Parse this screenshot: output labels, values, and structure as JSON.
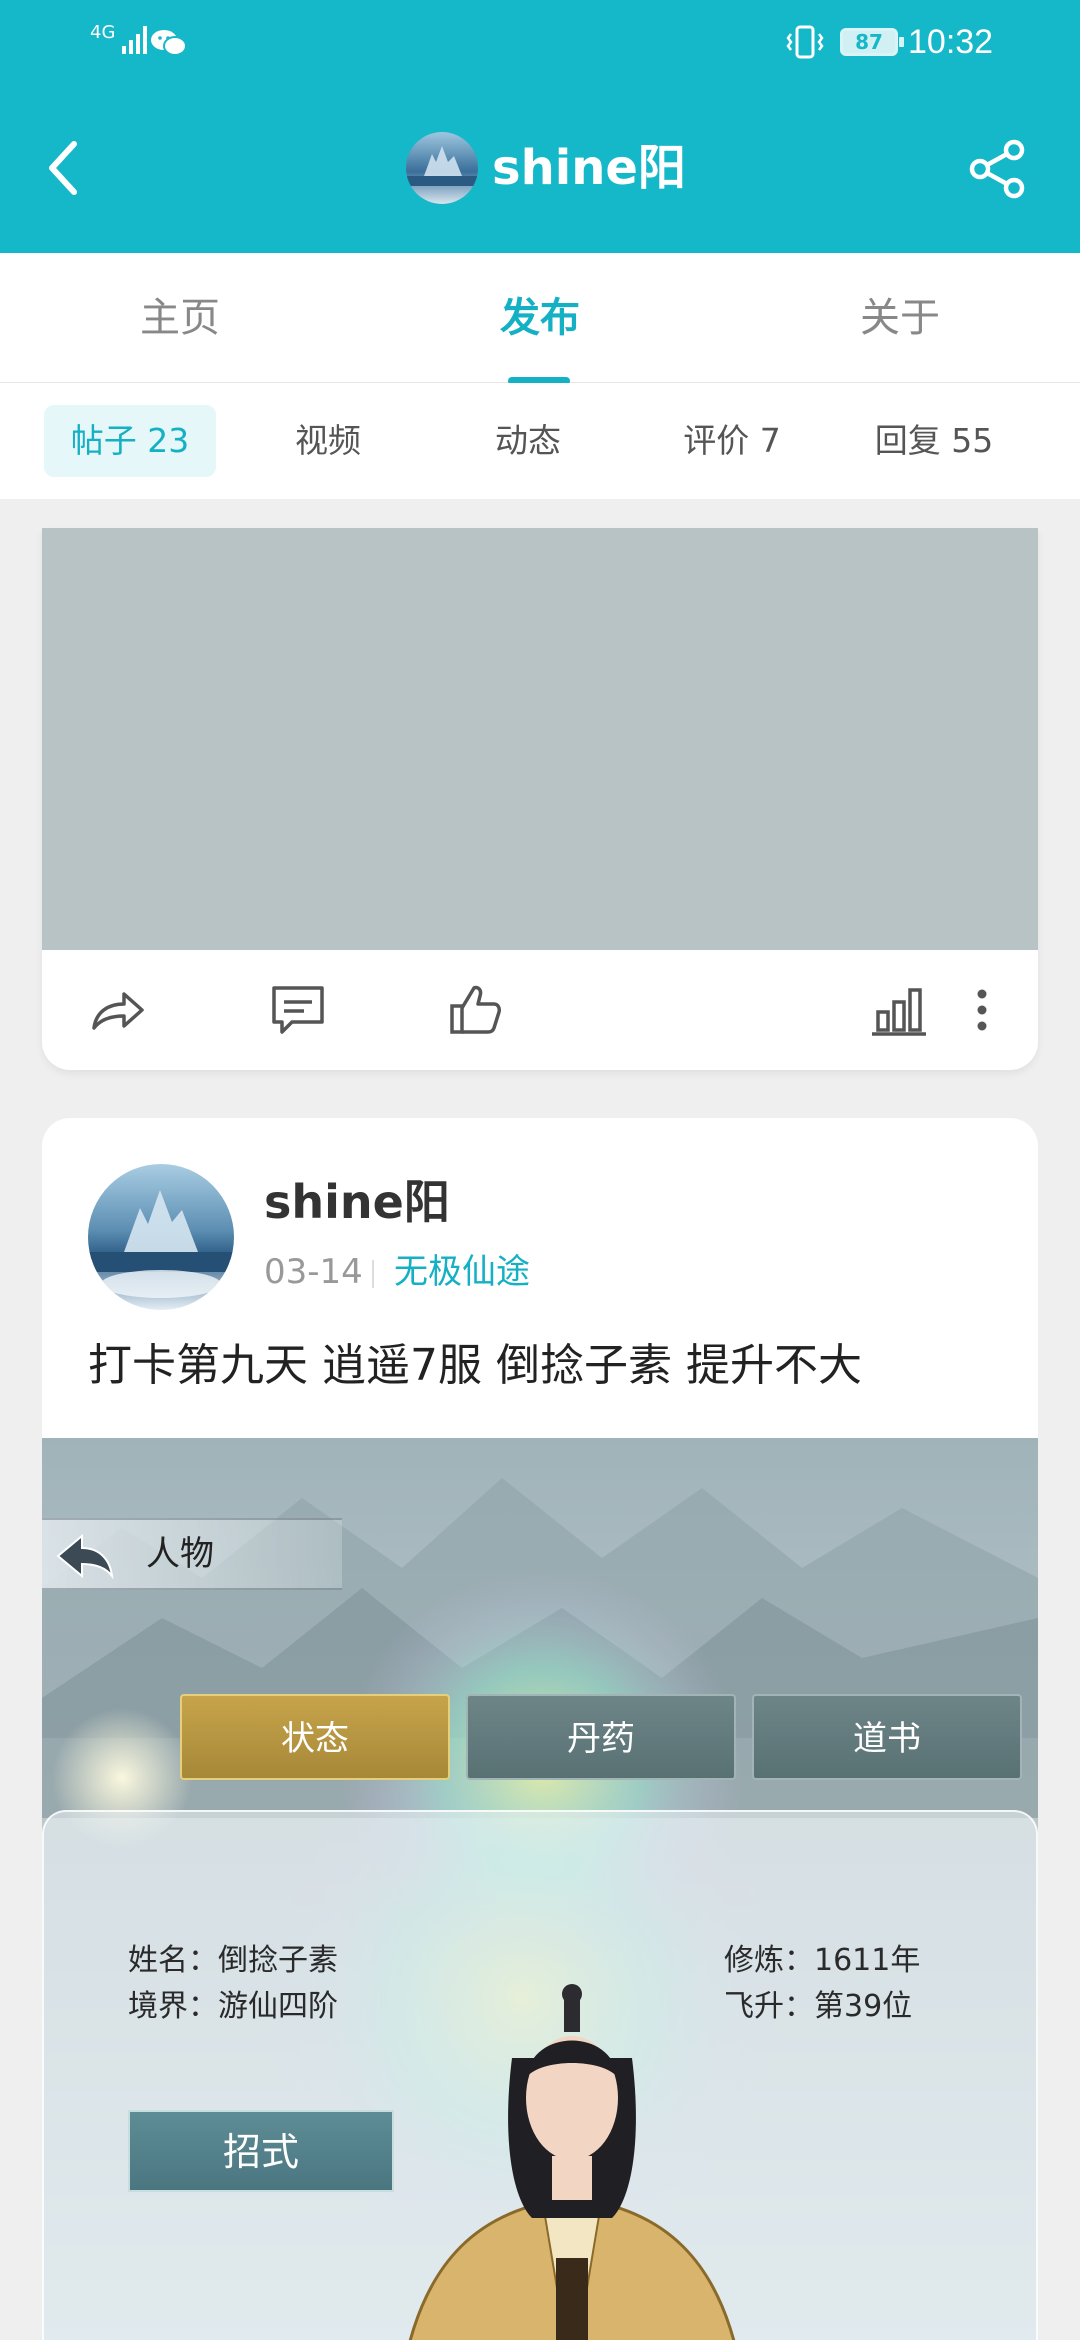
{
  "status_bar": {
    "signal_label": "4G",
    "battery": "87",
    "time": "10:32",
    "icons": [
      "signal-icon",
      "wechat-icon",
      "vibrate-icon",
      "battery-icon"
    ]
  },
  "header": {
    "title": "shine阳",
    "back_icon": "back-arrow-icon",
    "share_icon": "share-icon"
  },
  "main_tabs": [
    {
      "label": "主页",
      "active": false
    },
    {
      "label": "发布",
      "active": true
    },
    {
      "label": "关于",
      "active": false
    }
  ],
  "sub_tabs": [
    {
      "label": "帖子 23",
      "active": true
    },
    {
      "label": "视频",
      "active": false
    },
    {
      "label": "动态",
      "active": false
    },
    {
      "label": "评价 7",
      "active": false
    },
    {
      "label": "回复 55",
      "active": false
    }
  ],
  "post1": {
    "actions": [
      "share-icon",
      "comment-icon",
      "like-icon",
      "stats-icon",
      "more-icon"
    ]
  },
  "post2": {
    "username": "shine阳",
    "date": "03-14",
    "game": "无极仙途",
    "text": "打卡第九天 逍遥7服 倒捻子素 提升不大",
    "screenshot": {
      "title": "人物",
      "tabs": [
        "状态",
        "丹药",
        "道书"
      ],
      "name_line": "姓名：倒捻子素",
      "realm_line": "境界：游仙四阶",
      "cultivation_line": "修炼：1611年",
      "ascension_line": "飞升：第39位",
      "skill_button": "招式"
    }
  },
  "colors": {
    "accent": "#14b0c3",
    "header_bg": "#14b8c8",
    "placeholder_media": "#b7c3c5"
  }
}
